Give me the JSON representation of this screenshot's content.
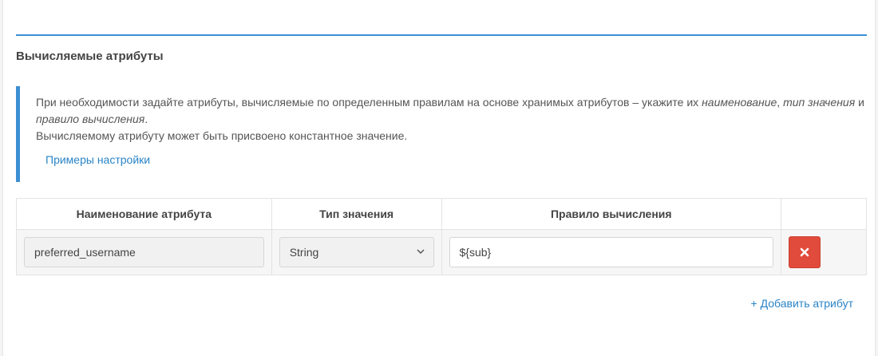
{
  "section": {
    "title": "Вычисляемые атрибуты"
  },
  "info": {
    "line1_a": "При необходимости задайте атрибуты, вычисляемые по определенным правилам на основе хранимых атрибутов – укажите их ",
    "line1_name": "наименование",
    "line1_sep": ", ",
    "line1_type": "тип значения",
    "line1_and": " и ",
    "line1_rule": "правило вычисления",
    "line1_end": ".",
    "line2": "Вычисляемому атрибуту может быть присвоено константное значение.",
    "example_link": "Примеры настройки"
  },
  "table": {
    "headers": [
      "Наименование атрибута",
      "Тип значения",
      "Правило вычисления",
      ""
    ],
    "rows": [
      {
        "name": "preferred_username",
        "type": "String",
        "rule": "${sub}"
      }
    ]
  },
  "add_link": "+ Добавить атрибут",
  "icons": {
    "delete": "close-icon",
    "select": "chevron-down-icon"
  },
  "colors": {
    "accent": "#3b8fd4",
    "link": "#2a84c6",
    "danger": "#e04b3c"
  }
}
